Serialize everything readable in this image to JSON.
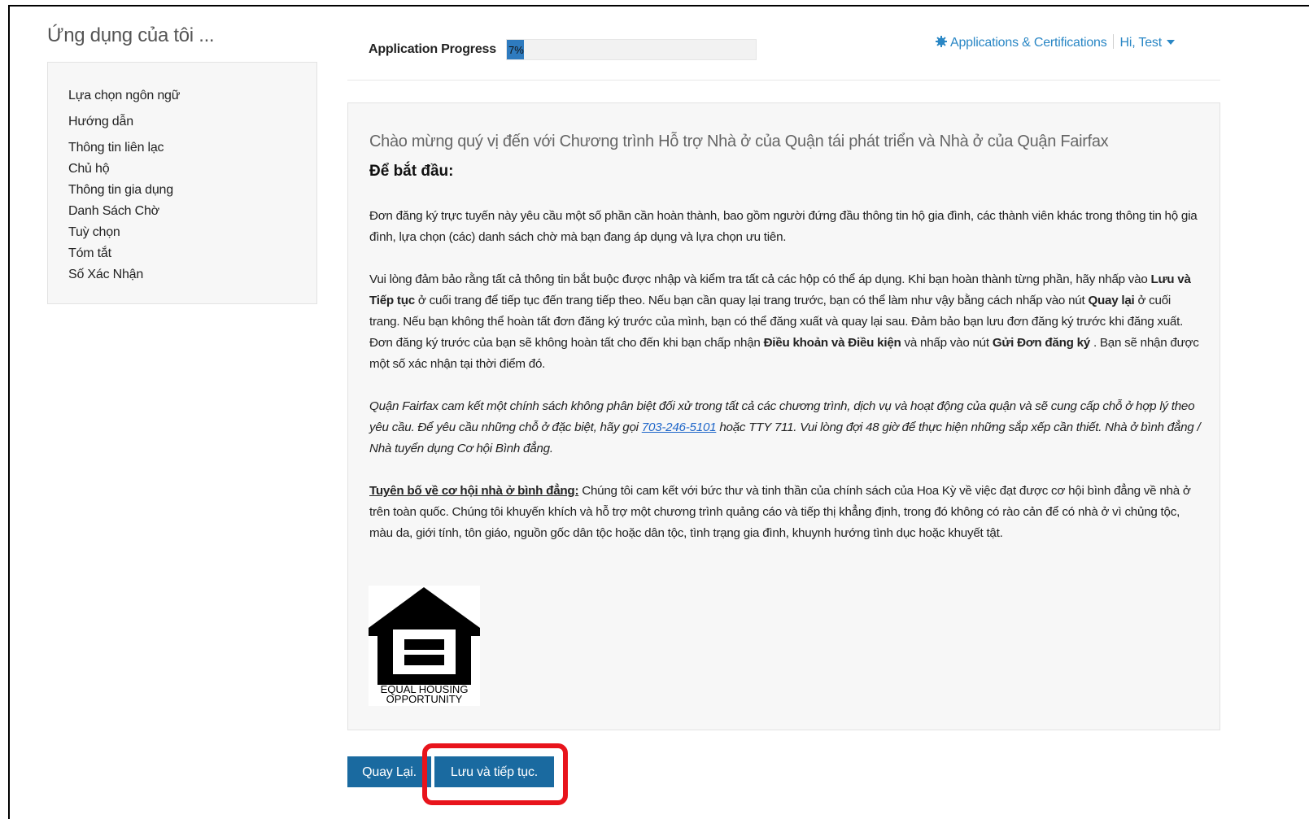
{
  "sidebar": {
    "title": "Ứng dụng của tôi ...",
    "items": [
      {
        "label": "Lựa chọn ngôn ngữ"
      },
      {
        "label": "Hướng dẫn"
      },
      {
        "label": "Thông tin liên lạc"
      },
      {
        "label": "Chủ hộ"
      },
      {
        "label": "Thông tin gia dụng"
      },
      {
        "label": "Danh Sách Chờ"
      },
      {
        "label": "Tuỳ chọn"
      },
      {
        "label": "Tóm tắt"
      },
      {
        "label": "Số Xác Nhận"
      }
    ]
  },
  "progress": {
    "label": "Application Progress",
    "value_text": "7%",
    "value": 0.07,
    "color": "#2e7bbf"
  },
  "topnav": {
    "icon": "gear-icon",
    "applications_link": "Applications & Certifications",
    "user_menu": "Hi, Test",
    "link_color": "#2a87c5"
  },
  "content": {
    "welcome": "Chào mừng quý vị đến với Chương trình Hỗ trợ Nhà ở của Quận tái phát triển và Nhà ở của Quận Fairfax",
    "start_heading": "Để bắt đầu:",
    "p1": "Đơn đăng ký trực tuyến này yêu cầu một số phần cần hoàn thành, bao gồm người đứng đầu thông tin hộ gia đình, các thành viên khác trong thông tin hộ gia đình, lựa chọn (các) danh sách chờ mà bạn đang áp dụng và lựa chọn ưu tiên.",
    "p2": {
      "t1": "Vui lòng đảm bảo rằng tất cả thông tin bắt buộc được nhập và kiểm tra tất cả các hộp có thể áp dụng. Khi bạn hoàn thành từng phần, hãy nhấp vào ",
      "b1": "Lưu và Tiếp tục",
      "t2": " ở cuối trang để tiếp tục đến trang tiếp theo. Nếu bạn cần quay lại trang trước, bạn có thể làm như vậy bằng cách nhấp vào nút ",
      "b2": "Quay lại",
      "t3": " ở cuối trang. Nếu bạn không thể hoàn tất đơn đăng ký trước của mình, bạn có thể đăng xuất và quay lại sau. Đảm bảo bạn lưu đơn đăng ký trước khi đăng xuất. Đơn đăng ký trước của bạn sẽ không hoàn tất cho đến khi bạn chấp nhận ",
      "b3": "Điều khoản và Điều kiện",
      "t4": " và nhấp vào nút ",
      "b4": "Gửi Đơn đăng ký",
      "t5": " . Bạn sẽ nhận được một số xác nhận tại thời điểm đó."
    },
    "p3": {
      "t1": "Quận Fairfax cam kết một chính sách không phân biệt đối xử trong tất cả các chương trình, dịch vụ và hoạt động của quận và sẽ cung cấp chỗ ở hợp lý theo yêu cầu. Để yêu cầu những chỗ ở đặc biệt, hãy gọi ",
      "phone": "703-246-5101",
      "t2": " hoặc TTY 711. Vui lòng đợi 48 giờ để thực hiện những sắp xếp cần thiết. Nhà ở bình đẳng / Nhà tuyển dụng Cơ hội Bình đẳng."
    },
    "p4": {
      "heading": "Tuyên bố về cơ hội nhà ở bình đẳng:",
      "text": " Chúng tôi cam kết với bức thư và tinh thần của chính sách của Hoa Kỳ về việc đạt được cơ hội bình đẳng về nhà ở trên toàn quốc. Chúng tôi khuyến khích và hỗ trợ một chương trình quảng cáo và tiếp thị khẳng định, trong đó không có rào cản để có nhà ở vì chủng tộc, màu da, giới tính, tôn giáo, nguồn gốc dân tộc hoặc dân tộc, tình trạng gia đình, khuynh hướng tình dục hoặc khuyết tật."
    },
    "logo": {
      "line1": "EQUAL HOUSING",
      "line2": "OPPORTUNITY"
    }
  },
  "buttons": {
    "back": "Quay Lại.",
    "save": "Lưu và tiếp tục.",
    "color": "#1a6aa0",
    "highlight_color": "#e8141c"
  }
}
